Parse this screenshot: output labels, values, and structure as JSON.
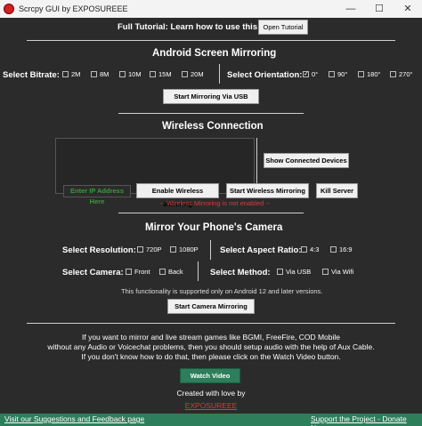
{
  "window": {
    "title": "Scrcpy GUI by EXPOSUREEE",
    "minimize": "—",
    "maximize": "☐",
    "close": "✕"
  },
  "tutorial": {
    "label": "Full Tutorial: Learn how to use this app",
    "button": "Open Tutorial"
  },
  "mirroring": {
    "heading": "Android Screen Mirroring",
    "bitrate_label": "Select Bitrate:",
    "bitrates": [
      "2M",
      "8M",
      "10M",
      "15M",
      "20M"
    ],
    "orientation_label": "Select Orientation:",
    "orientations": [
      "0°",
      "90°",
      "180°",
      "270°"
    ],
    "selected_orientation": "0°",
    "start_button": "Start Mirroring Via USB"
  },
  "wireless": {
    "heading": "Wireless Connection",
    "show_devices_button": "Show Connected Devices",
    "ip_placeholder": "Enter IP Address Here",
    "enable_button": "Enable Wireless Mirroring",
    "start_button": "Start Wireless Mirroring",
    "kill_button": "Kill Server",
    "status": "-- Wireless Mirroring is not enabled --"
  },
  "camera": {
    "heading": "Mirror Your Phone's Camera",
    "resolution_label": "Select Resolution:",
    "resolutions": [
      "720P",
      "1080P"
    ],
    "aspect_label": "Select Aspect Ratio:",
    "aspects": [
      "4:3",
      "16:9"
    ],
    "camera_label": "Select Camera:",
    "cameras": [
      "Front",
      "Back"
    ],
    "method_label": "Select Method:",
    "methods": [
      "Via USB",
      "Via Wifi"
    ],
    "note": "This functionality is supported only on Android 12 and later versions.",
    "start_button": "Start Camera Mirroring"
  },
  "info": {
    "line1": "If you want to mirror and live stream games like BGMI, FreeFire, COD Mobile",
    "line2": "without any Audio or Voicechat problems, then you should setup audio with the help of Aux Cable.",
    "line3": "If you don't know how to do that, then please click on the Watch Video button.",
    "watch_button": "Watch Video",
    "credit": "Created with love by",
    "author": "EXPOSUREEE"
  },
  "footer": {
    "left_link": "Visit our Suggestions and Feedback page",
    "right_link": "Support the Project - Donate Now"
  },
  "colors": {
    "accent_green": "#2e7d5b",
    "link_red": "#d93a3a",
    "background": "#2b2b2b"
  }
}
